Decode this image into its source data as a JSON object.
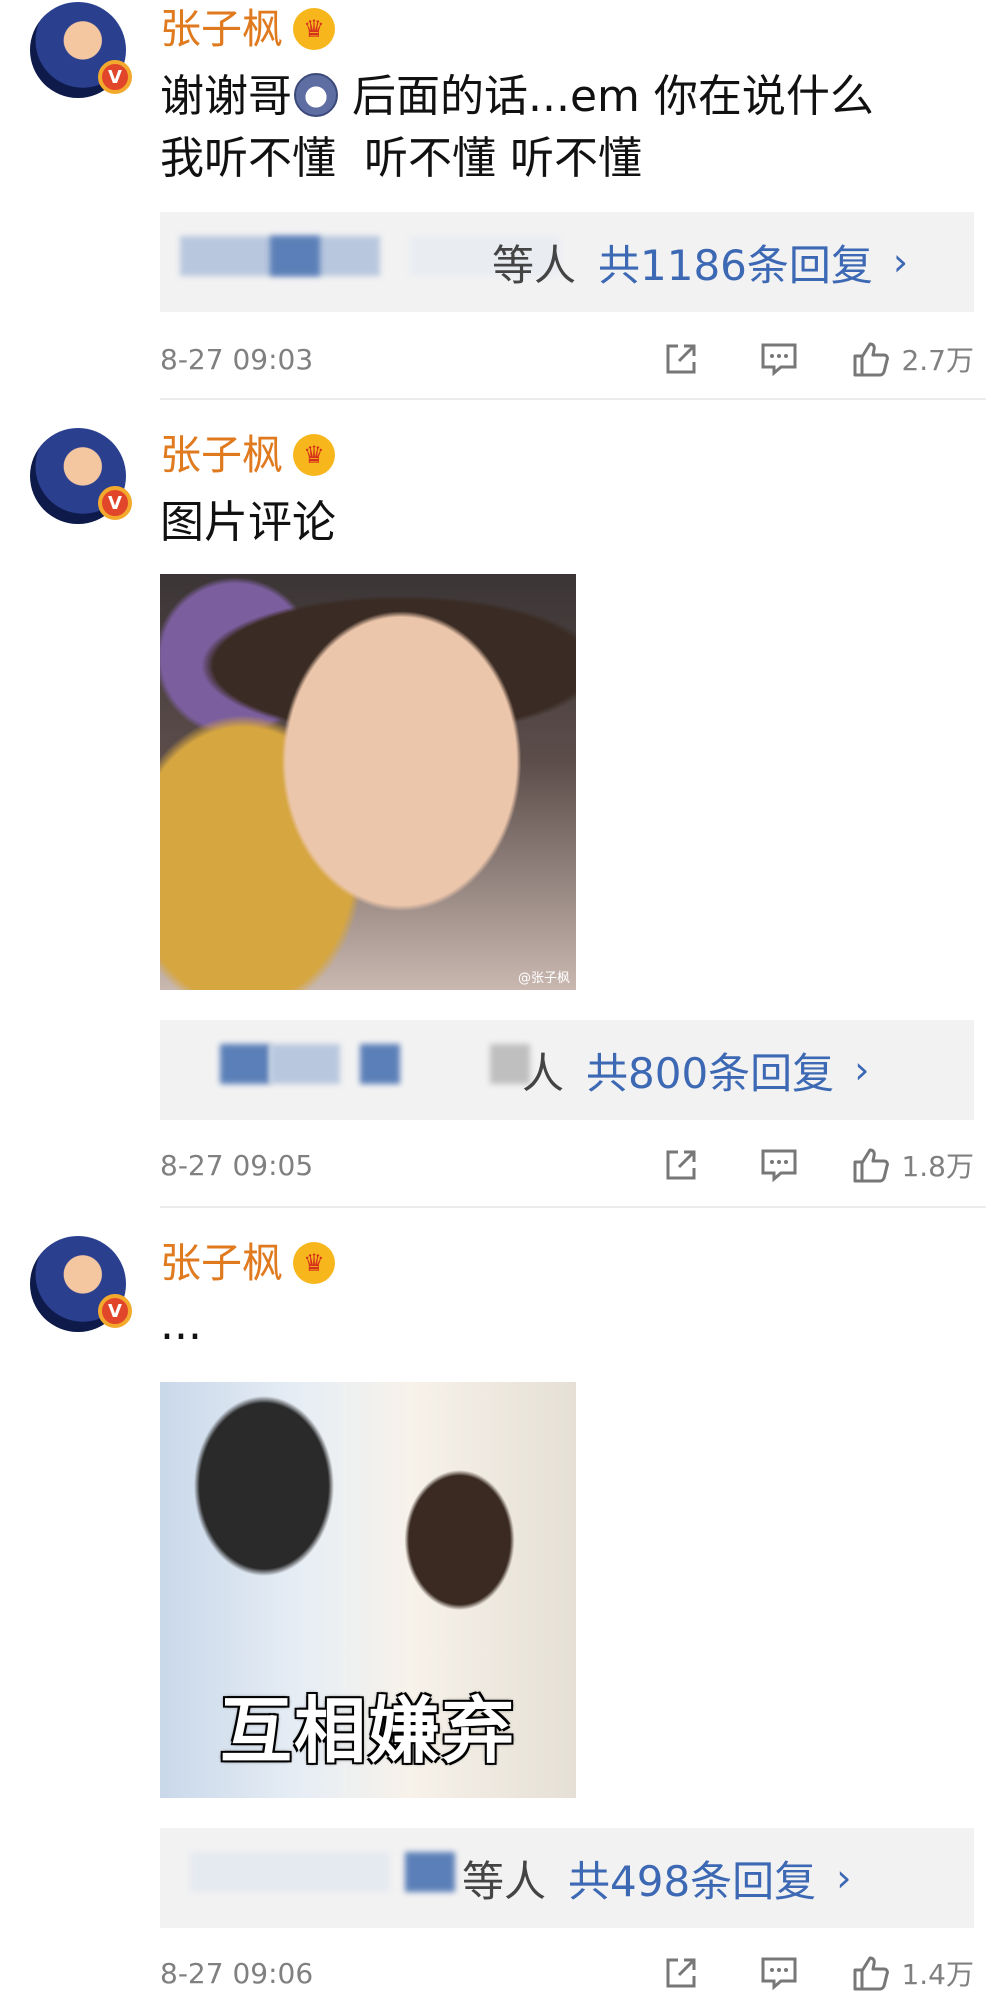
{
  "comments": [
    {
      "username": "张子枫",
      "text_line1": "谢谢哥",
      "text_line1b": " 后面的话...em 你在说什么",
      "text_line2": "我听不懂  听不懂 听不懂",
      "reply_suffix": "等人",
      "reply_link": "共1186条回复",
      "time": "8-27 09:03",
      "likes": "2.7万"
    },
    {
      "username": "张子枫",
      "text": "图片评论",
      "image_watermark": "@张子枫",
      "reply_suffix": "人",
      "reply_link": "共800条回复",
      "time": "8-27 09:05",
      "likes": "1.8万"
    },
    {
      "username": "张子枫",
      "text": "...",
      "image_caption": "互相嫌弃",
      "reply_suffix": "等人",
      "reply_link": "共498条回复",
      "time": "8-27 09:06",
      "likes": "1.4万"
    }
  ],
  "badges": {
    "verified": "V"
  },
  "icons": [
    "share-icon",
    "comment-icon",
    "like-icon",
    "chevron-right-icon",
    "crown-icon",
    "verified-badge-icon"
  ],
  "colors": {
    "username": "#e07a1f",
    "link": "#3c68b4",
    "meta": "#808080",
    "reply_bg": "#f2f2f2"
  }
}
